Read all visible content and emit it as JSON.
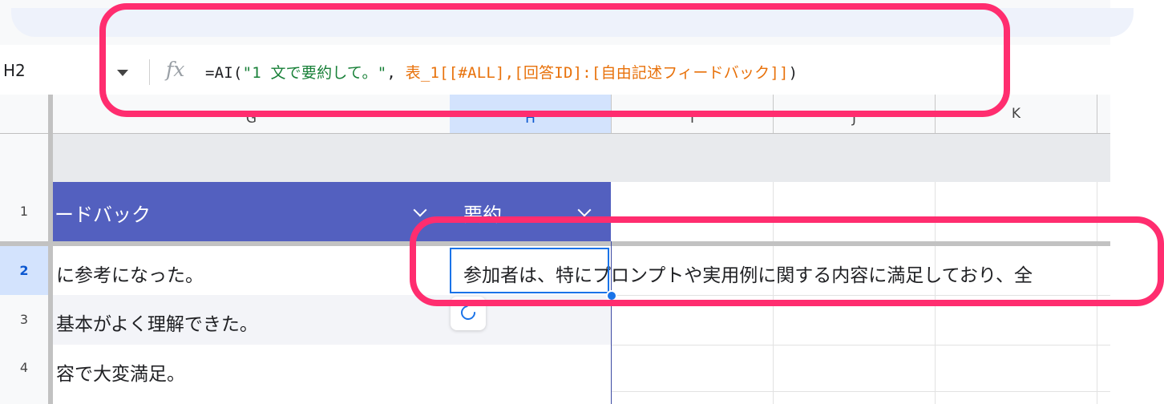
{
  "formula_bar": {
    "name_box": "H2",
    "fx_icon": "fx",
    "formula_tokens": [
      {
        "text": "=AI(",
        "kind": "op"
      },
      {
        "text": "\"1 文で要約して。\"",
        "kind": "str"
      },
      {
        "text": ", ",
        "kind": "op"
      },
      {
        "text": "表_1[[#ALL],[回答ID]:[自由記述フィードバック]]",
        "kind": "ref"
      },
      {
        "text": ")",
        "kind": "op"
      }
    ]
  },
  "columns": {
    "g": "G",
    "h": "H",
    "i": "I",
    "j": "J",
    "k": "K"
  },
  "rows": [
    "1",
    "2",
    "3",
    "4"
  ],
  "table": {
    "header_col_g": "ードバック",
    "header_col_h": "要約",
    "cells_col_g": [
      "に参考になった。",
      "基本がよく理解できた。",
      "容で大変満足。"
    ],
    "cell_h2": "参加者は、特にプロンプトや実用例に関する内容に満足しており、全"
  },
  "icons": {
    "name_dropdown": "triangle-down-icon",
    "filter_chevron": "chevron-down-icon",
    "refresh": "refresh-icon"
  },
  "colors": {
    "table_header": "#5360bf",
    "selection": "#1a73e8",
    "annotation": "#ff2d6f",
    "formula_string": "#188038",
    "formula_ref": "#e8710a"
  }
}
